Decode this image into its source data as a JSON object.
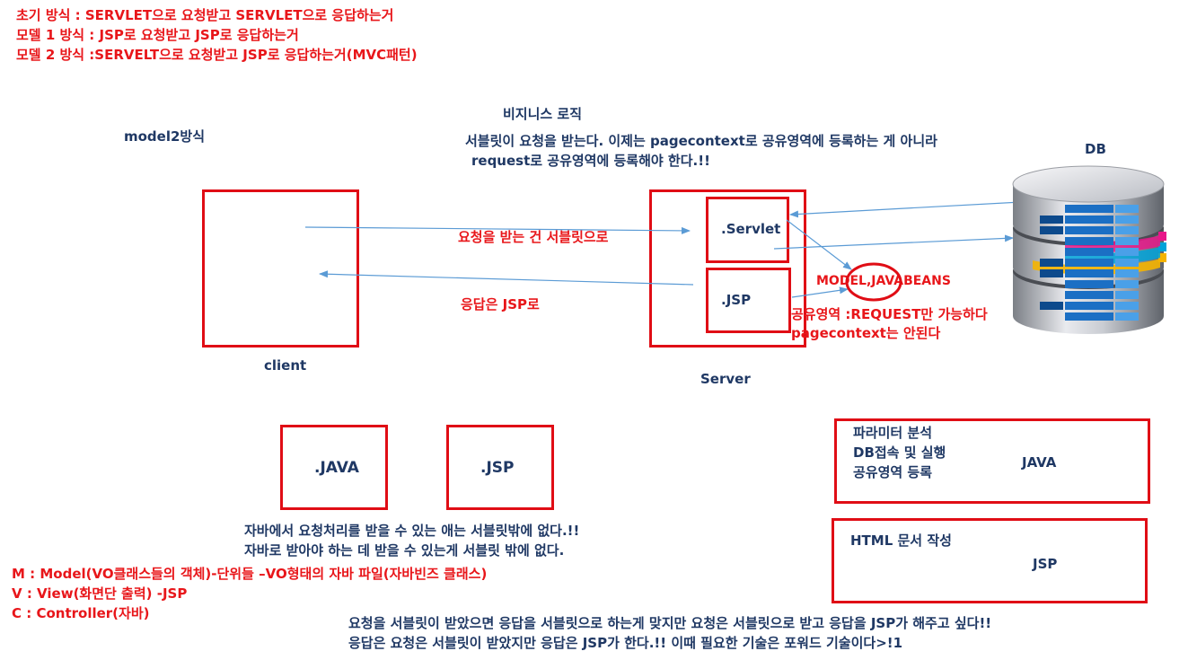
{
  "intro": {
    "line1": "초기 방식 : SERVLET으로 요청받고 SERVLET으로 응답하는거",
    "line2": "모델 1 방식 : JSP로 요청받고 JSP로 응답하는거",
    "line3": "모델 2 방식  :SERVELT으로 요청받고 JSP로 응답하는거(MVC패턴)"
  },
  "model2_label": "model2방식",
  "business": {
    "title": "비지니스 로직",
    "line1": "서블릿이 요청을 받는다. 이제는 pagecontext로 공유영역에 등록하는 게 아니라",
    "line2": "request로  공유영역에 등록해야 한다.!!"
  },
  "db_label": "DB",
  "client_label": "client",
  "server_label": "Server",
  "servlet_label": ".Servlet",
  "jsp_label": ".JSP",
  "request_arrow_label": "요청을 받는 건 서블릿으로",
  "response_arrow_label": "응답은 JSP로",
  "javabeans_label": "MODEL,JAVABEANS",
  "shared_area": {
    "line1": "공유영역 :REQUEST만  가능하다",
    "line2": "pagecontext는 안된다"
  },
  "java_box_label": ".JAVA",
  "jsp_box_label": ".JSP",
  "java_note": {
    "line1": "자바에서 요청처리를 받을 수 있는 애는 서블릿밖에 없다.!!",
    "line2": "자바로 받아야 하는 데 받을 수 있는게 서블릿 밖에 없다."
  },
  "java_role": {
    "items": [
      "파라미터 분석",
      "DB접속 및 실행",
      "공유영역 등록"
    ],
    "label": "JAVA"
  },
  "jsp_role": {
    "title": "HTML 문서 작성",
    "label": "JSP"
  },
  "mvc": {
    "m": "M : Model(VO클래스들의 객체)-단위들 –VO형태의 자바 파일(자바빈즈 클래스)",
    "v": "V : View(화면단 출력)  -JSP",
    "c": "C : Controller(자바)"
  },
  "footer": {
    "line1": "요청을 서블릿이 받았으면 응답을 서블릿으로 하는게 맞지만 요청은 서블릿으로 받고 응답을 JSP가 해주고 싶다!!",
    "line2": "응답은 요청은 서블릿이 받았지만 응답은 JSP가 한다.!! 이때 필요한 기술은 포워드 기술이다>!1"
  },
  "colors": {
    "red": "#e8161a",
    "box_red": "#e00d15",
    "navy": "#1f3864",
    "arrow_blue": "#5b9bd5"
  }
}
